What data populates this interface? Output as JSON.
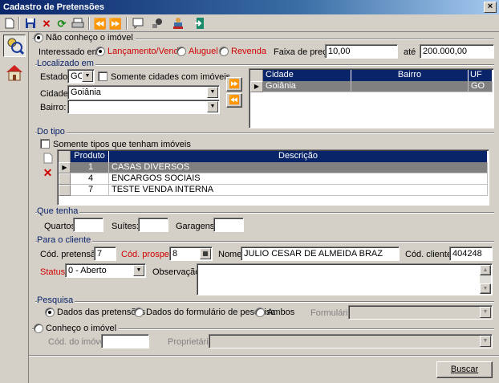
{
  "window": {
    "title": "Cadastro de Pretensões",
    "close": "×"
  },
  "toolbar": {
    "icons": [
      "new-icon",
      "save-icon",
      "delete-icon",
      "refresh-icon",
      "print-icon",
      "first-icon",
      "last-icon",
      "chat-icon",
      "tools-icon",
      "users-icon",
      "exit-icon"
    ]
  },
  "mode": {
    "nao_conheco": "Não conheço o imóvel",
    "conheco": "Conheço o imóvel"
  },
  "interesse": {
    "label": "Interessado em:",
    "opt1": "Lançamento/Venda",
    "opt2": "Aluguel",
    "opt3": "Revenda",
    "faixa_label": "Faixa de preço:",
    "preco_min": "10,00",
    "ate": "até",
    "preco_max": "200.000,00"
  },
  "localizado": {
    "title": "Localizado em",
    "estado_label": "Estado:",
    "estado": "GO",
    "somente_cidades": "Somente cidades com imóveis",
    "cidade_label": "Cidade:",
    "cidade": "Goiânia",
    "bairro_label": "Bairro:",
    "bairro": ""
  },
  "loc_grid": {
    "headers": [
      "Cidade",
      "Bairro",
      "UF"
    ],
    "rows": [
      [
        "Goiânia",
        "",
        "GO"
      ]
    ]
  },
  "tipo": {
    "title": "Do tipo",
    "somente_tipos": "Somente tipos que tenham imóveis",
    "headers": [
      "Produto",
      "Descrição"
    ],
    "rows": [
      [
        "1",
        "CASAS DIVERSOS"
      ],
      [
        "4",
        "ENCARGOS SOCIAIS"
      ],
      [
        "7",
        "TESTE VENDA INTERNA"
      ]
    ]
  },
  "quetenha": {
    "title": "Que tenha",
    "quartos": "Quartos:",
    "suites": "Suítes:",
    "garagens": "Garagens:"
  },
  "cliente": {
    "title": "Para o cliente",
    "cod_pretensao_label": "Cód. pretensão:",
    "cod_pretensao": "7",
    "cod_prospect_label": "Cód. prospect",
    "cod_prospect": "8",
    "nome_label": "Nome:",
    "nome": "JULIO CESAR DE ALMEIDA BRAZ",
    "cod_cliente_label": "Cód. cliente:",
    "cod_cliente": "404248",
    "status_label": "Status:",
    "status": "0 - Aberto",
    "obs_label": "Observação:"
  },
  "pesquisa": {
    "title": "Pesquisa",
    "opt1": "Dados das pretensões",
    "opt2": "Dados do formulário de pesquisa",
    "opt3": "Ambos",
    "formulario_label": "Formulário:"
  },
  "imovel": {
    "cod_label": "Cód. do imóvel:",
    "proprietario_label": "Proprietário:"
  },
  "buscar": "Buscar",
  "colors": {
    "title_start": "#0a246a",
    "highlight": "#0a246a",
    "red_label": "#d00000"
  }
}
